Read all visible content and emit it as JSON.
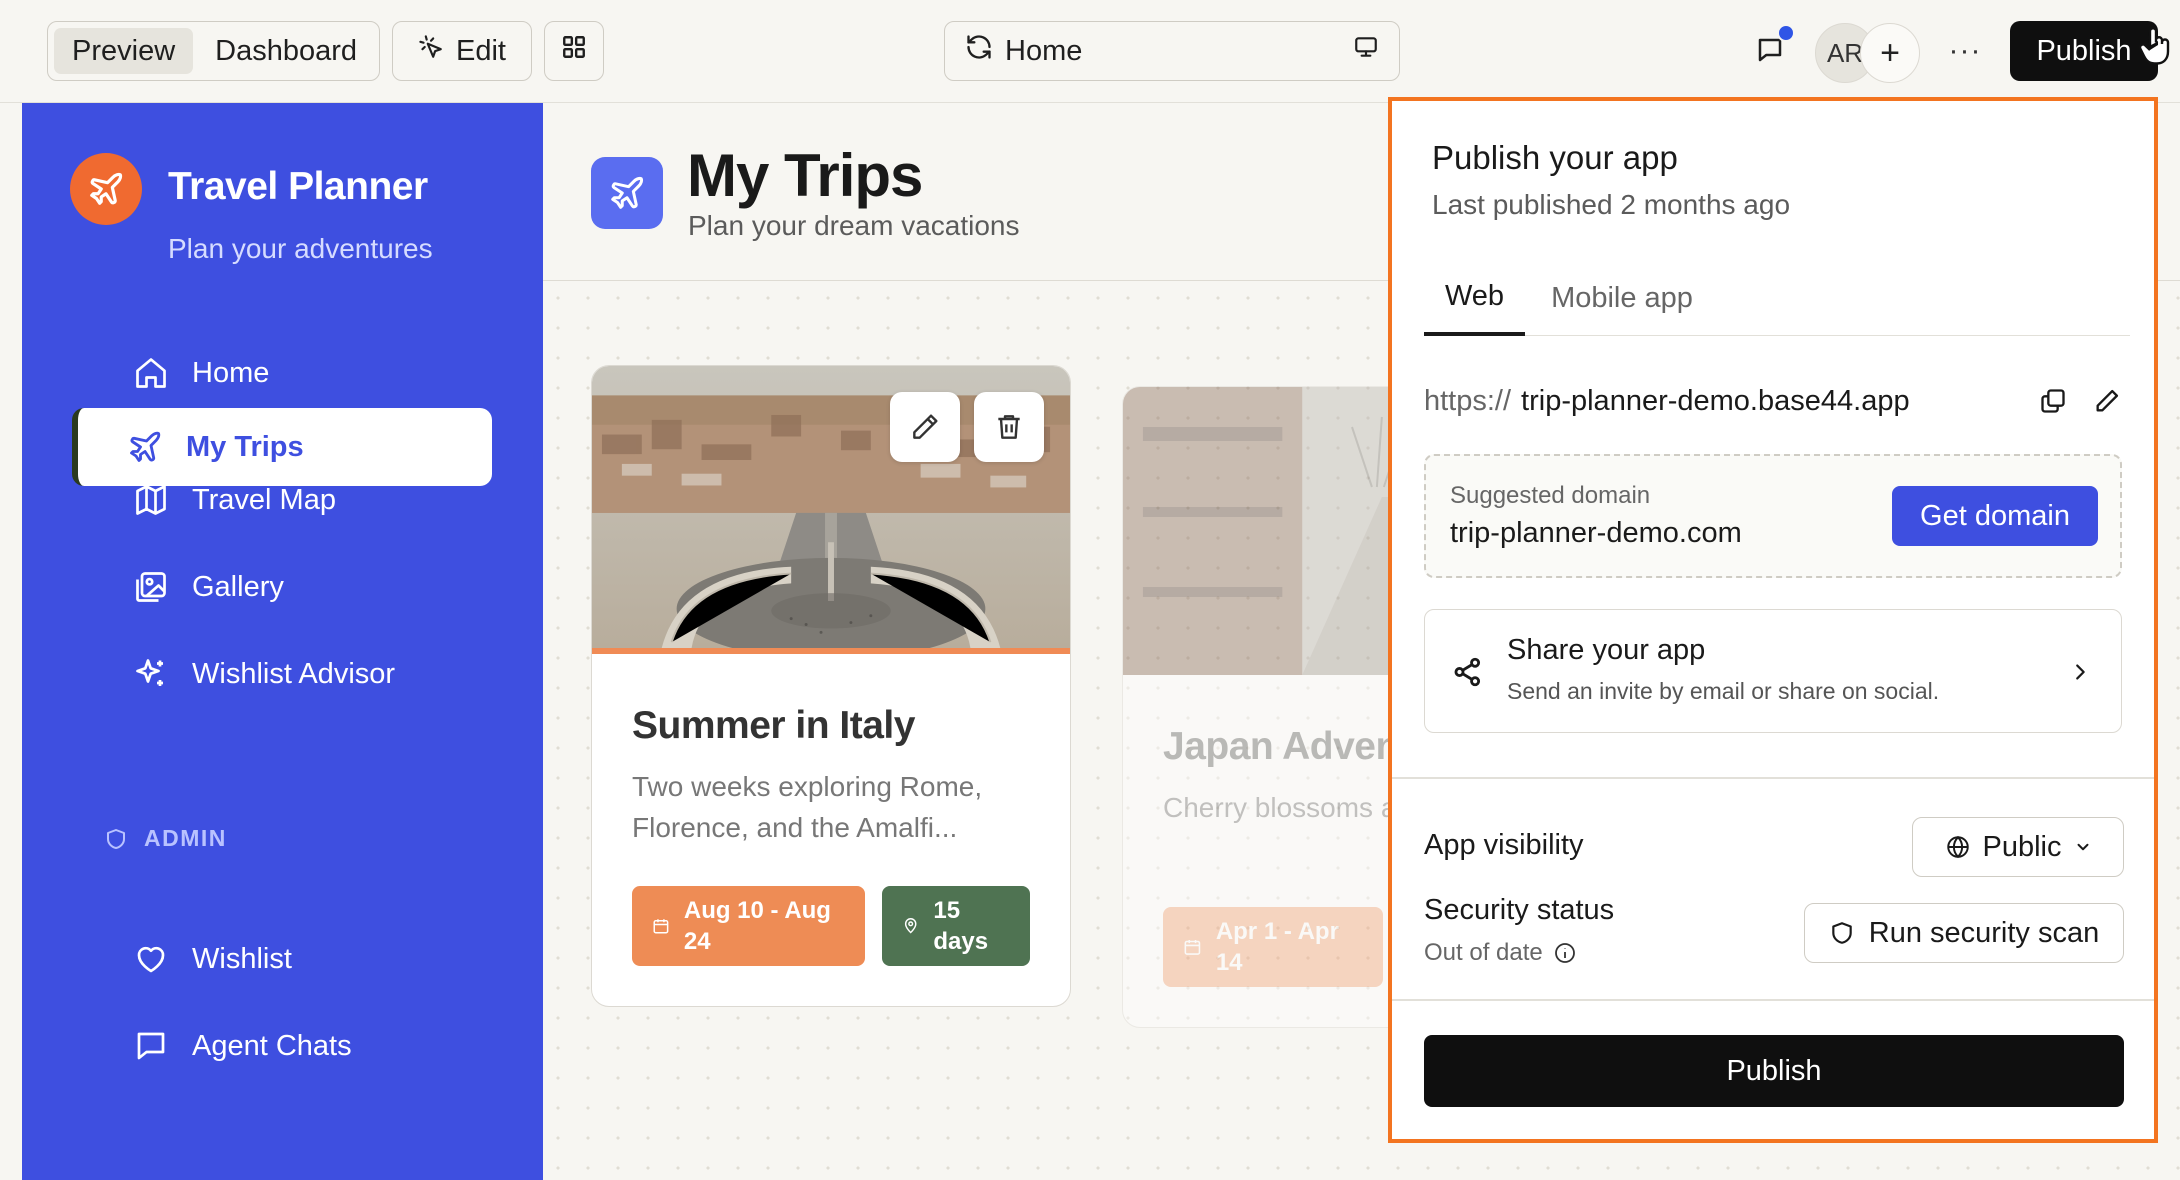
{
  "topbar": {
    "view_modes": [
      "Preview",
      "Dashboard"
    ],
    "active_view": "Preview",
    "edit_label": "Edit",
    "current_page": "Home",
    "avatar_initials": "AR",
    "more_label": "···",
    "publish_label": "Publish"
  },
  "sidebar": {
    "app_name": "Travel Planner",
    "tagline": "Plan your adventures",
    "items": [
      {
        "label": "Home",
        "icon": "home-icon",
        "active": false
      },
      {
        "label": "My Trips",
        "icon": "plane-icon",
        "active": true
      },
      {
        "label": "Travel Map",
        "icon": "map-icon",
        "active": false
      },
      {
        "label": "Gallery",
        "icon": "gallery-icon",
        "active": false
      },
      {
        "label": "Wishlist Advisor",
        "icon": "sparkle-icon",
        "active": false
      }
    ],
    "admin_label": "ADMIN",
    "admin_items": [
      {
        "label": "Wishlist",
        "icon": "heart-icon"
      },
      {
        "label": "Agent Chats",
        "icon": "chat-icon"
      }
    ]
  },
  "main": {
    "title": "My Trips",
    "subtitle": "Plan your dream vacations",
    "trips": [
      {
        "title": "Summer in Italy",
        "description": "Two weeks exploring Rome, Florence, and the Amalfi...",
        "dates": "Aug 10 - Aug 24",
        "duration": "15 days"
      },
      {
        "title": "Japan Adventure",
        "description": "Cherry blossoms and temples in Kyoto, Tokyo...",
        "dates": "Apr 1 - Apr 14"
      }
    ]
  },
  "publish_panel": {
    "title": "Publish your app",
    "last_published": "Last published 2 months ago",
    "tabs": [
      "Web",
      "Mobile app"
    ],
    "active_tab": "Web",
    "url_protocol": "https://",
    "url_host": "trip-planner-demo.base44.app",
    "suggested_domain_label": "Suggested domain",
    "suggested_domain": "trip-planner-demo.com",
    "get_domain_label": "Get domain",
    "share_title": "Share your app",
    "share_subtitle": "Send an invite by email or share on social.",
    "visibility_label": "App visibility",
    "visibility_value": "Public",
    "security_label": "Security status",
    "security_status": "Out of date",
    "scan_label": "Run security scan",
    "publish_label": "Publish"
  },
  "colors": {
    "sidebar": "#3e4fe0",
    "accent_orange": "#f37420",
    "logo": "#f06a30",
    "chip_date": "#ee8c55",
    "chip_days": "#4f7352",
    "notification_dot": "#2f55e6"
  }
}
